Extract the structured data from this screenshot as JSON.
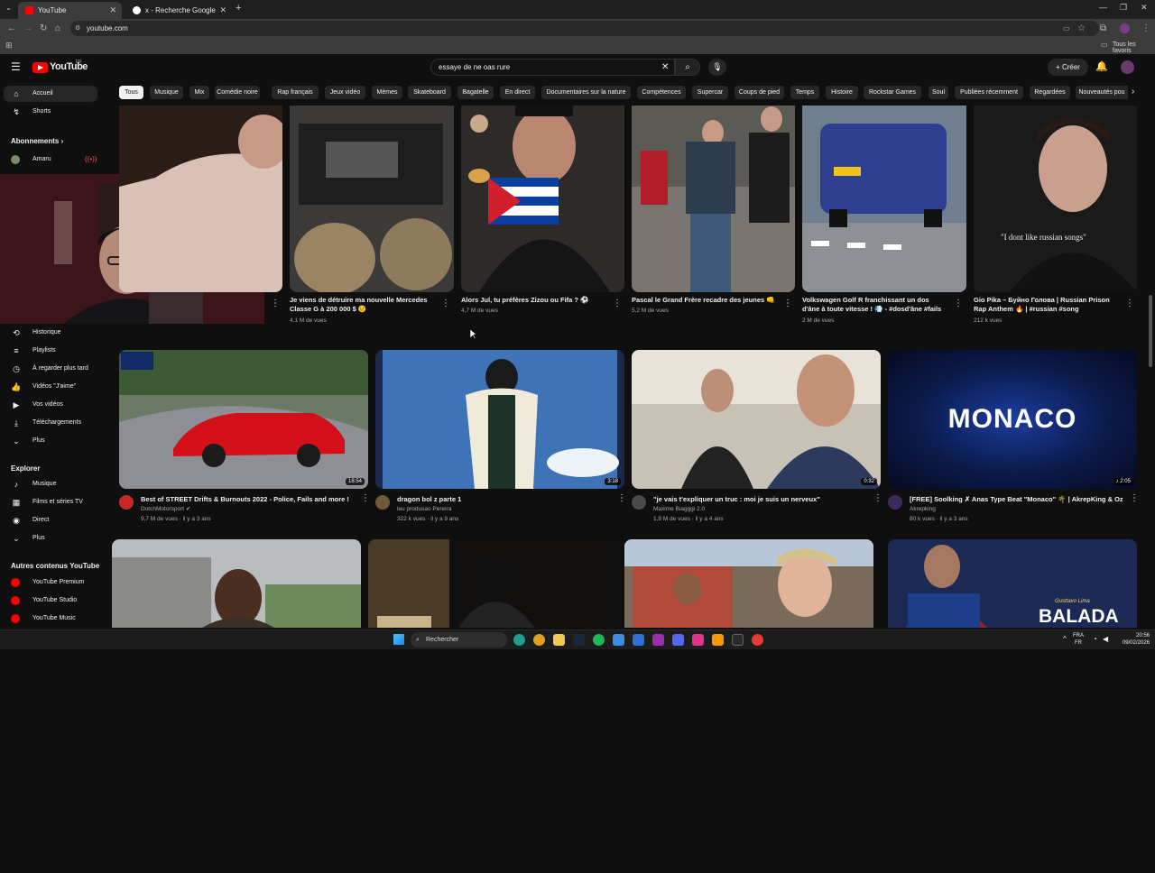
{
  "browser": {
    "tabs": [
      {
        "label": "YouTube",
        "active": true
      },
      {
        "label": "x - Recherche Google",
        "active": false
      }
    ],
    "url": "youtube.com",
    "bookmarks_label": "Tous les favoris"
  },
  "youtube": {
    "logo": "YouTube",
    "logo_region": "FR",
    "search": {
      "value": "essaye de ne oas rure"
    },
    "create_label": "Créer"
  },
  "chips": [
    "Tous",
    "Musique",
    "Mix",
    "Comédie noire",
    "Rap français",
    "Jeux vidéo",
    "Mèmes",
    "Skateboard",
    "Bagatelle",
    "En direct",
    "Documentaires sur la nature",
    "Compétences",
    "Supercar",
    "Coups de pied",
    "Temps",
    "Histoire",
    "Rockstar Games",
    "Soul",
    "Publiées récemment",
    "Regardées",
    "Nouveautés pou"
  ],
  "sidebar": {
    "top": [
      {
        "label": "Accueil",
        "icon": "home-icon"
      },
      {
        "label": "Shorts",
        "icon": "shorts-icon"
      }
    ],
    "subscriptions_heading": "Abonnements",
    "subscriptions": [
      {
        "label": "Amaru"
      }
    ],
    "you": [
      {
        "label": "Historique",
        "icon": "history-icon"
      },
      {
        "label": "Playlists",
        "icon": "playlist-icon"
      },
      {
        "label": "À regarder plus tard",
        "icon": "clock-icon"
      },
      {
        "label": "Vidéos \"J'aime\"",
        "icon": "thumb-up-icon"
      },
      {
        "label": "Vos vidéos",
        "icon": "video-icon"
      },
      {
        "label": "Téléchargements",
        "icon": "download-icon"
      },
      {
        "label": "Plus",
        "icon": "chevron-down-icon"
      }
    ],
    "explore_heading": "Explorer",
    "explore": [
      {
        "label": "Musique",
        "icon": "music-icon"
      },
      {
        "label": "Films et séries TV",
        "icon": "film-icon"
      },
      {
        "label": "Direct",
        "icon": "live-icon"
      },
      {
        "label": "Plus",
        "icon": "chevron-down-icon"
      }
    ],
    "more_heading": "Autres contenus YouTube",
    "more": [
      {
        "label": "YouTube Premium"
      },
      {
        "label": "YouTube Studio"
      },
      {
        "label": "YouTube Music"
      }
    ]
  },
  "row1": [
    {
      "title": "",
      "views": ""
    },
    {
      "title": "Je viens de détruire ma nouvelle Mercedes Classe G à 200 000 $ 😢",
      "views": "4,1 M de vues"
    },
    {
      "title": "Alors Jul, tu préfères Zizou ou Fifa ? ⚽",
      "views": "4,7 M de vues"
    },
    {
      "title": "Pascal le Grand Frère recadre des jeunes 👊",
      "views": "5,2 M de vues"
    },
    {
      "title": "Volkswagen Golf R franchissant un dos d'âne à toute vitesse ! 💨 - #dosd'âne #fails ...",
      "views": "2 M de vues"
    },
    {
      "title": "Gio Pika – Буйно Голова | Russian Prison Rap Anthem 🔥 | #russian #song",
      "views": "212 k vues"
    }
  ],
  "row1_overlay_text": "\"I dont like russian songs\"",
  "row2": [
    {
      "title": "Best of STREET Drifts & Burnouts 2022 - Police, Fails and more !",
      "channel": "DutchMotorsport ✔",
      "meta": "9,7 M de vues · il y a 3 ans",
      "duration": "18:54"
    },
    {
      "title": "dragon bol z parte 1",
      "channel": "leu produsao Pereira",
      "meta": "322 k vues · il y a 9 ans",
      "duration": "3:18"
    },
    {
      "title": "\"je vais t'expliquer un truc : moi je suis un nerveux\"",
      "channel": "Maxime Biagggi 2.0",
      "meta": "1,9 M de vues · il y a 4 ans",
      "duration": "0:32"
    },
    {
      "title": "[FREE] Soolking ✗ Anas Type Beat \"Monaco\" 🌴 | AkrepKing & Oz",
      "channel": "Akrepking",
      "meta": "80 k vues · il y a 3 ans",
      "duration": "♪ 2:05"
    }
  ],
  "monaco_text": "MONACO",
  "balada_text": "BALADA",
  "gusttavo_text": "Gusttavo Lima",
  "taskbar": {
    "search": "Rechercher",
    "lang": "FRA",
    "lang2": "FR",
    "time": "20:56",
    "date": "09/02/2026"
  },
  "colors": {
    "bg": "#0f0f0f",
    "brand": "#ff0000",
    "chip": "#272727"
  }
}
